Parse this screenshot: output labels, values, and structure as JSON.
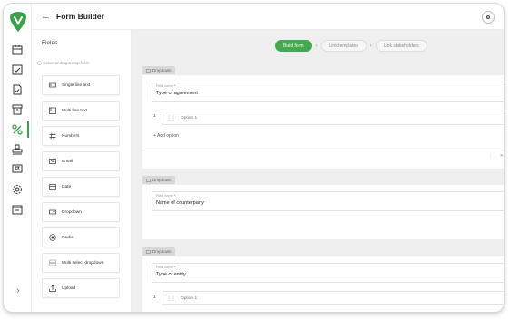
{
  "header": {
    "back_symbol": "←",
    "title": "Form Builder",
    "help_icon": "help-circle-icon"
  },
  "rail": {
    "accent": "#3aa14a",
    "items": [
      "calendar-icon",
      "inbox-check-icon",
      "document-check-icon",
      "archive-icon",
      "percent-tool-icon",
      "stamp-icon",
      "flag-icon",
      "settings-icon",
      "list-box-icon"
    ],
    "active_index": 4,
    "expand_symbol": "›"
  },
  "fields_panel": {
    "title": "Fields",
    "hint": "Select or drag & drop fields",
    "items": [
      {
        "label": "Single line text",
        "icon": "single-line-text-icon"
      },
      {
        "label": "Multi line text",
        "icon": "multi-line-text-icon"
      },
      {
        "label": "Numbers",
        "icon": "hash-icon"
      },
      {
        "label": "Email",
        "icon": "mail-icon"
      },
      {
        "label": "Date",
        "icon": "calendar-icon"
      },
      {
        "label": "Dropdown",
        "icon": "dropdown-icon"
      },
      {
        "label": "Radio",
        "icon": "radio-icon"
      },
      {
        "label": "Multi select dropdown",
        "icon": "multi-select-icon"
      },
      {
        "label": "Upload",
        "icon": "upload-icon"
      }
    ]
  },
  "steps": [
    {
      "label": "Build form",
      "active": true
    },
    {
      "label": "Link templates",
      "active": false
    },
    {
      "label": "Link stakeholders",
      "active": false
    }
  ],
  "sections": [
    {
      "tag": "Dropdown",
      "field_label": "Field name",
      "required_mark": "*",
      "field_value": "Type of agreement",
      "option_number": "1",
      "option_placeholder": "Option 1",
      "add_option": "+ Add option"
    },
    {
      "tag": "Dropdown",
      "field_label": "Field name",
      "required_mark": "*",
      "field_value": "Name of counterparty"
    },
    {
      "tag": "Dropdown",
      "field_label": "Field name",
      "required_mark": "*",
      "field_value": "Type of entity",
      "option_number": "1",
      "option_placeholder": "Option 1"
    }
  ],
  "colors": {
    "accent_green": "#45a94f",
    "canvas_bg": "#efefef"
  }
}
